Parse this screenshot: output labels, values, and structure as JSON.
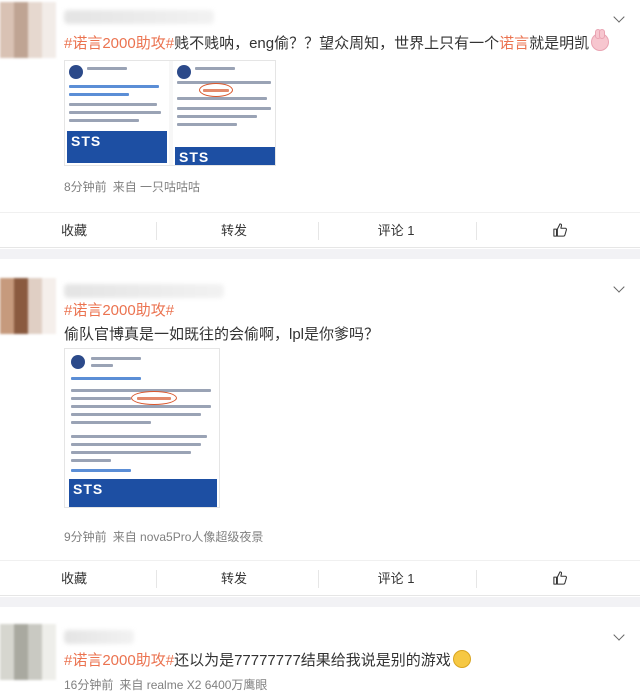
{
  "posts": [
    {
      "hashtag": "#诺言2000助攻#",
      "text_parts": [
        "贱不贱呐，eng偷？？望众周知，世界上只有一个",
        "诺言",
        "就是明凯"
      ],
      "emoji": "bunny-emoji",
      "time": "8分钟前",
      "source": "来自 一只咕咕咕",
      "screenshot_banner": "STS"
    },
    {
      "hashtag": "#诺言2000助攻#",
      "text": "偷队官博真是一如既往的会偷啊，lpl是你爹吗？",
      "time": "9分钟前",
      "source": "来自 nova5Pro人像超级夜景",
      "screenshot_banner": "STS"
    },
    {
      "hashtag": "#诺言2000助攻#",
      "text": "还以为是77777777结果给我说是别的游戏",
      "emoji": "dizzy-emoji",
      "time": "16分钟前",
      "source": "来自 realme X2 6400万鹰眼"
    }
  ],
  "actions": {
    "collect": "收藏",
    "repost": "转发",
    "comment": "评论 1",
    "like_icon": "thumbs-up-icon"
  },
  "colors": {
    "accent": "#eb7350",
    "meta": "#808080",
    "divider": "#f2f2f5"
  }
}
